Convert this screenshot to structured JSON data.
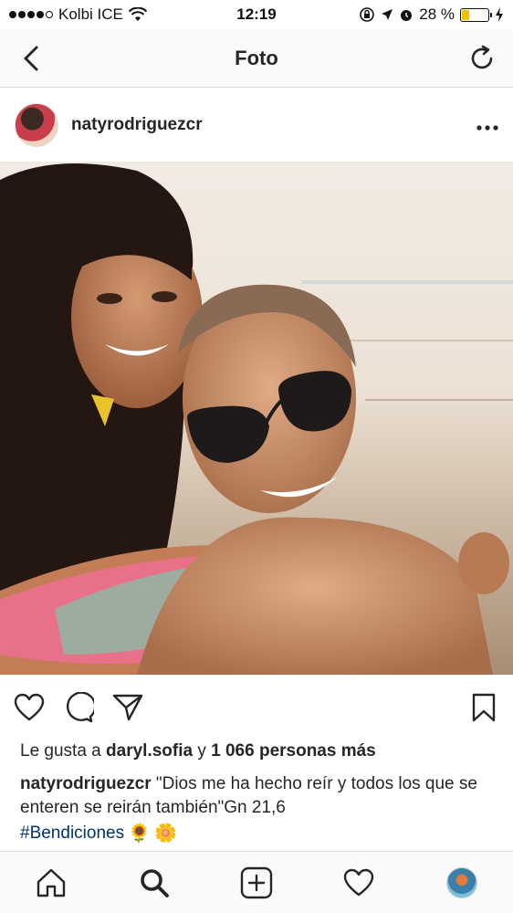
{
  "status_bar": {
    "carrier": "Kolbi ICE",
    "time": "12:19",
    "battery_percent": "28 %",
    "battery_level": 0.28,
    "battery_color": "#f2c100"
  },
  "nav": {
    "title": "Foto",
    "back_icon": "chevron-left-icon",
    "refresh_icon": "refresh-icon"
  },
  "post": {
    "username": "natyrodriguezcr",
    "more_icon": "more-horizontal-icon",
    "actions": [
      "heart-icon",
      "comment-icon",
      "share-icon",
      "bookmark-icon"
    ],
    "likes": {
      "prefix": "Le gusta a",
      "user": "daryl.sofia",
      "connector": "y",
      "others": "1 066 personas más"
    },
    "caption": {
      "author": "natyrodriguezcr",
      "text": "\"Dios me ha hecho reír y todos los que se enteren se reirán también\"Gn 21,6"
    },
    "hashtag": "#Bendiciones",
    "emoji_1": "🌻",
    "emoji_2": "🌼"
  },
  "tab_bar": {
    "items": [
      "home-icon",
      "search-icon",
      "new-post-icon",
      "activity-icon",
      "profile-avatar"
    ]
  },
  "colors": {
    "text": "#262626",
    "hashtag": "#003569",
    "divider": "#dbdbdb"
  }
}
